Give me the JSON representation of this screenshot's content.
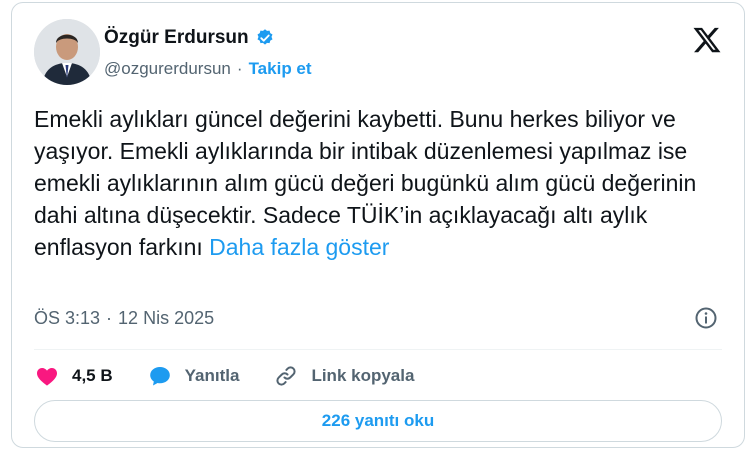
{
  "author": {
    "name": "Özgür Erdursun",
    "handle": "@ozgurerdursun",
    "separator": "·",
    "follow_label": "Takip et"
  },
  "tweet": {
    "text": "Emekli aylıkları güncel değerini kaybetti. Bunu herkes biliyor ve yaşıyor. Emekli aylıklarında bir intibak düzenlemesi yapılmaz ise emekli aylıklarının alım gücü değeri bugünkü alım gücü değerinin dahi altına düşecektir. Sadece TÜİK’in açıklayacağı altı aylık enflasyon farkını",
    "show_more": "Daha fazla göster"
  },
  "meta": {
    "time": "ÖS 3:13",
    "separator": "·",
    "date": "12 Nis 2025"
  },
  "actions": {
    "likes": "4,5 B",
    "reply_label": "Yanıtla",
    "copy_link_label": "Link kopyala"
  },
  "replies_button": "226 yanıtı oku",
  "colors": {
    "accent": "#1d9bf0",
    "like": "#f91880",
    "text": "#0f1419",
    "muted": "#536471",
    "border": "#cfd9de"
  },
  "icons": {
    "verified": "verified-badge-icon",
    "platform": "x-logo-icon",
    "info": "info-icon",
    "like": "heart-icon",
    "reply": "speech-bubble-icon",
    "link": "link-icon"
  }
}
